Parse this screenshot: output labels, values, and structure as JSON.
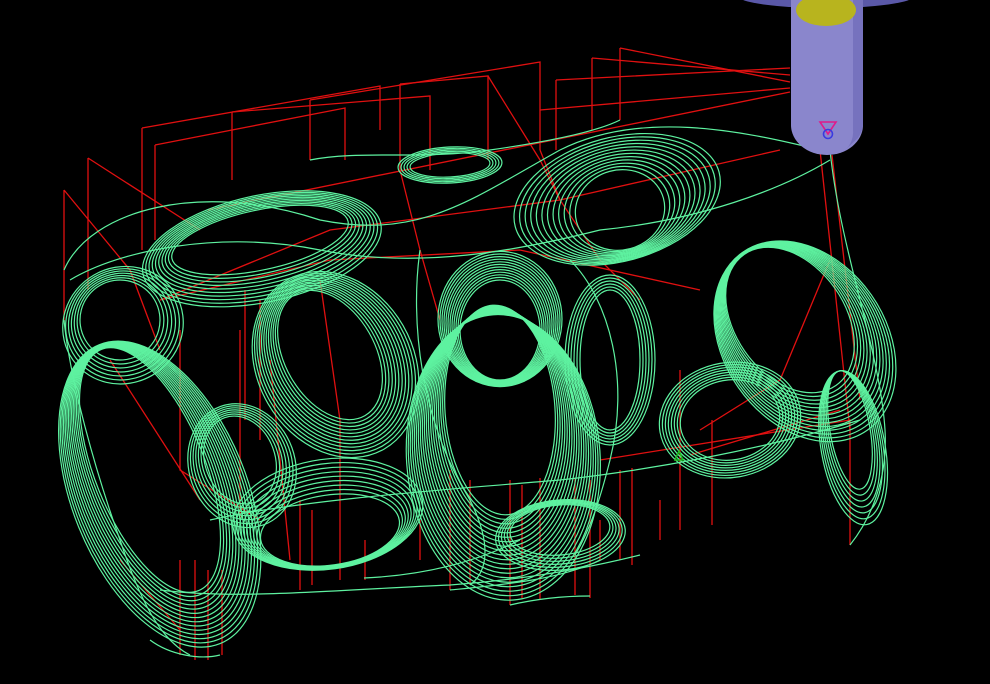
{
  "viewport": {
    "background": "#000000"
  },
  "colors": {
    "toolpath_cut": "#5ef2a0",
    "toolpath_rapid": "#e01010",
    "tool_shank": "#8a86cc",
    "tool_tip_highlight": "#b8b41e",
    "tool_holder": "#5a58a8",
    "marker_end": "#e01a8a",
    "marker_center": "#3a3ae0",
    "marker_start": "#20c020"
  },
  "icons": {
    "tool": "cutter-tool-icon",
    "end_marker": "end-point-triangle-icon",
    "start_marker": "start-point-triangle-icon"
  }
}
